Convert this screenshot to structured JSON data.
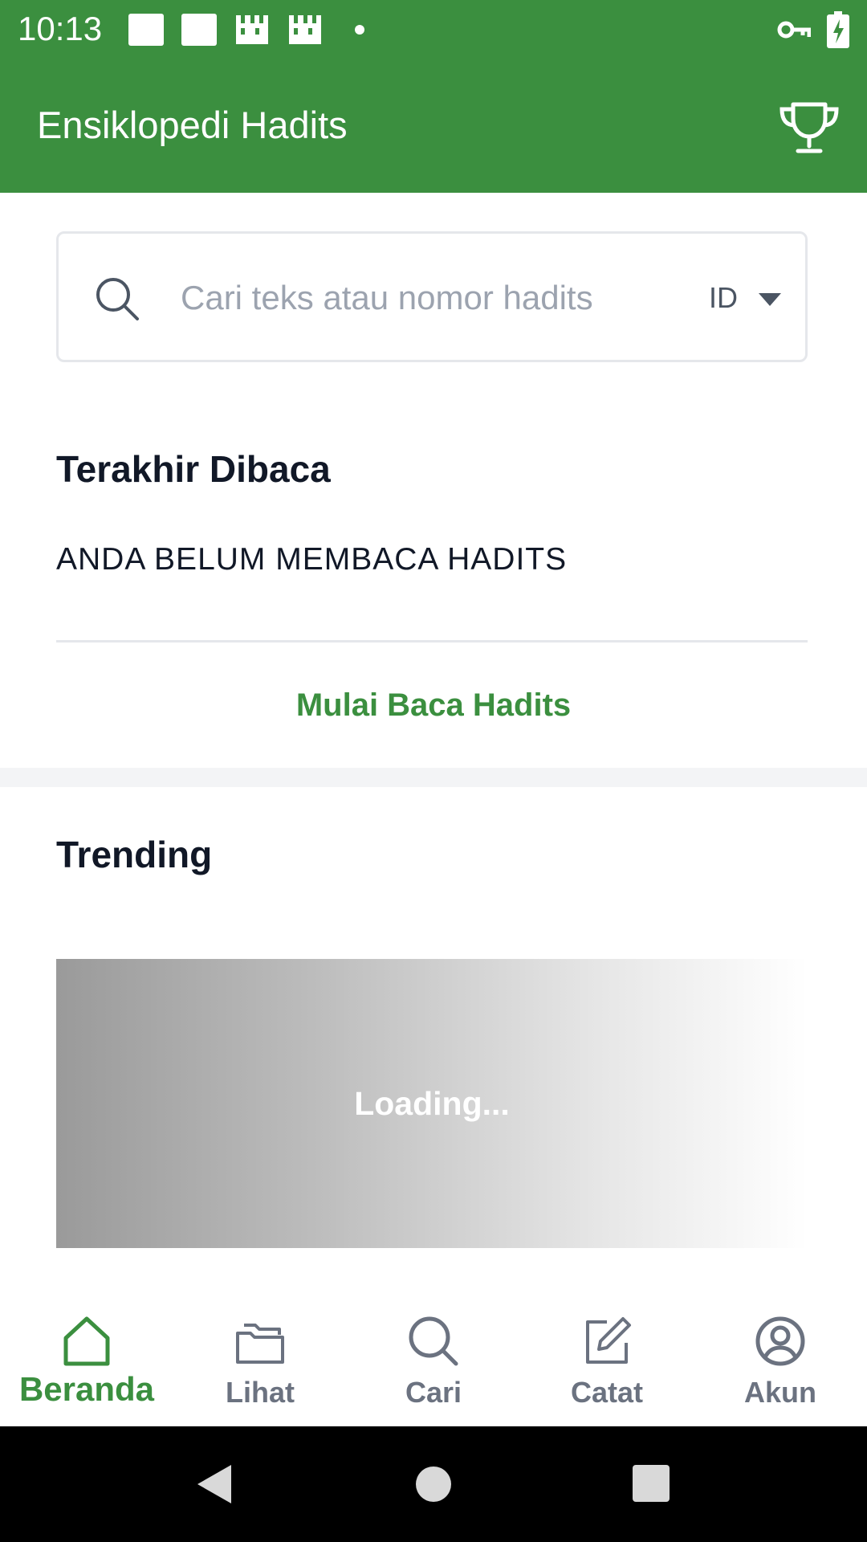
{
  "status_bar": {
    "time": "10:13",
    "icons": [
      "square-notification-icon",
      "square-notification-icon",
      "grid-notification-icon",
      "grid-notification-icon",
      "dot-icon",
      "vpn-key-icon",
      "battery-charging-icon"
    ]
  },
  "app_bar": {
    "title": "Ensiklopedi Hadits",
    "trophy_icon": "trophy-icon"
  },
  "search": {
    "placeholder": "Cari teks atau nomor hadits",
    "value": "",
    "language": "ID",
    "icon": "search-icon"
  },
  "last_read": {
    "title": "Terakhir Dibaca",
    "empty_message": "ANDA BELUM MEMBACA HADITS",
    "action_label": "Mulai Baca Hadits"
  },
  "trending": {
    "title": "Trending",
    "loading_label": "Loading..."
  },
  "bottom_nav": {
    "items": [
      {
        "label": "Beranda",
        "icon": "home-icon",
        "active": true
      },
      {
        "label": "Lihat",
        "icon": "folder-icon",
        "active": false
      },
      {
        "label": "Cari",
        "icon": "search-icon",
        "active": false
      },
      {
        "label": "Catat",
        "icon": "edit-note-icon",
        "active": false
      },
      {
        "label": "Akun",
        "icon": "account-icon",
        "active": false
      }
    ]
  },
  "colors": {
    "brand_green": "#3b8f3f",
    "inactive_gray": "#6b7280",
    "text_dark": "#111827"
  }
}
